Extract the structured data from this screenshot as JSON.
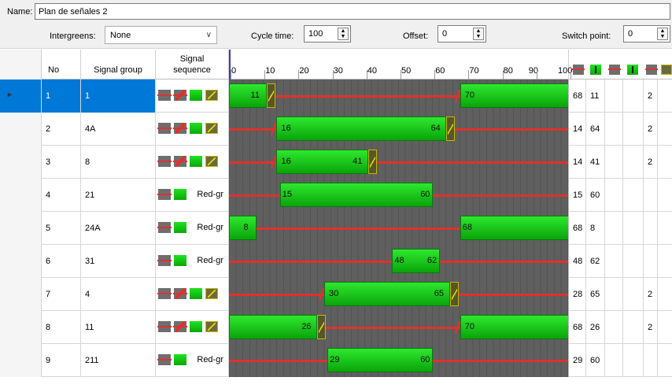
{
  "name": {
    "label": "Name:",
    "value": "Plan de señales 2"
  },
  "toolbar": {
    "intergreens_label": "Intergreens:",
    "intergreens_value": "None",
    "cycle_label": "Cycle time:",
    "cycle_value": "100",
    "offset_label": "Offset:",
    "offset_value": "0",
    "switch_label": "Switch point:",
    "switch_value": "0"
  },
  "columns": {
    "no": "No",
    "signal_group": "Signal group",
    "signal_sequence_line1": "Signal",
    "signal_sequence_line2": "sequence"
  },
  "cycle_time": 100,
  "ticks": [
    "0",
    "10",
    "20",
    "30",
    "40",
    "50",
    "60",
    "70",
    "80",
    "90",
    "100"
  ],
  "header_icons": [
    "red-icon",
    "green-down-icon",
    "red-icon",
    "green-down-icon",
    "red-amber-icon",
    "amber-icon"
  ],
  "rows": [
    {
      "no": "1",
      "group": "1",
      "seq": "full",
      "seq_text": "",
      "selected": true,
      "green_start": 68,
      "green_end": 11,
      "amber_at": 11,
      "redamber_at": 68,
      "label_start": "70",
      "label_end": "11",
      "c1": "68",
      "c2": "11",
      "c3": "",
      "c4": "",
      "c5": "2",
      "c6": ""
    },
    {
      "no": "2",
      "group": "4A",
      "seq": "full",
      "seq_text": "",
      "selected": false,
      "green_start": 14,
      "green_end": 64,
      "amber_at": 64,
      "redamber_at": 14,
      "label_start": "16",
      "label_end": "64",
      "c1": "14",
      "c2": "64",
      "c3": "",
      "c4": "",
      "c5": "2",
      "c6": ""
    },
    {
      "no": "3",
      "group": "8",
      "seq": "full",
      "seq_text": "",
      "selected": false,
      "green_start": 14,
      "green_end": 41,
      "amber_at": 41,
      "redamber_at": 14,
      "label_start": "16",
      "label_end": "41",
      "c1": "14",
      "c2": "41",
      "c3": "",
      "c4": "",
      "c5": "2",
      "c6": ""
    },
    {
      "no": "4",
      "group": "21",
      "seq": "short",
      "seq_text": "Red-gr",
      "selected": false,
      "green_start": 15,
      "green_end": 60,
      "amber_at": null,
      "redamber_at": null,
      "label_start": "15",
      "label_end": "60",
      "c1": "15",
      "c2": "60",
      "c3": "",
      "c4": "",
      "c5": "",
      "c6": ""
    },
    {
      "no": "5",
      "group": "24A",
      "seq": "short",
      "seq_text": "Red-gr",
      "selected": false,
      "green_start": 68,
      "green_end": 8,
      "amber_at": null,
      "redamber_at": null,
      "label_start": "68",
      "label_end": "8",
      "c1": "68",
      "c2": "8",
      "c3": "",
      "c4": "",
      "c5": "",
      "c6": ""
    },
    {
      "no": "6",
      "group": "31",
      "seq": "short",
      "seq_text": "Red-gr",
      "selected": false,
      "green_start": 48,
      "green_end": 62,
      "amber_at": null,
      "redamber_at": null,
      "label_start": "48",
      "label_end": "62",
      "c1": "48",
      "c2": "62",
      "c3": "",
      "c4": "",
      "c5": "",
      "c6": ""
    },
    {
      "no": "7",
      "group": "4",
      "seq": "full",
      "seq_text": "",
      "selected": false,
      "green_start": 28,
      "green_end": 65,
      "amber_at": 65,
      "redamber_at": 28,
      "label_start": "30",
      "label_end": "65",
      "c1": "28",
      "c2": "65",
      "c3": "",
      "c4": "",
      "c5": "2",
      "c6": ""
    },
    {
      "no": "8",
      "group": "11",
      "seq": "full",
      "seq_text": "",
      "selected": false,
      "green_start": 68,
      "green_end": 26,
      "amber_at": 26,
      "redamber_at": 68,
      "label_start": "70",
      "label_end": "26",
      "c1": "68",
      "c2": "26",
      "c3": "",
      "c4": "",
      "c5": "2",
      "c6": ""
    },
    {
      "no": "9",
      "group": "211",
      "seq": "short",
      "seq_text": "Red-gr",
      "selected": false,
      "green_start": 29,
      "green_end": 60,
      "amber_at": null,
      "redamber_at": null,
      "label_start": "29",
      "label_end": "60",
      "c1": "29",
      "c2": "60",
      "c3": "",
      "c4": "",
      "c5": "",
      "c6": ""
    }
  ]
}
